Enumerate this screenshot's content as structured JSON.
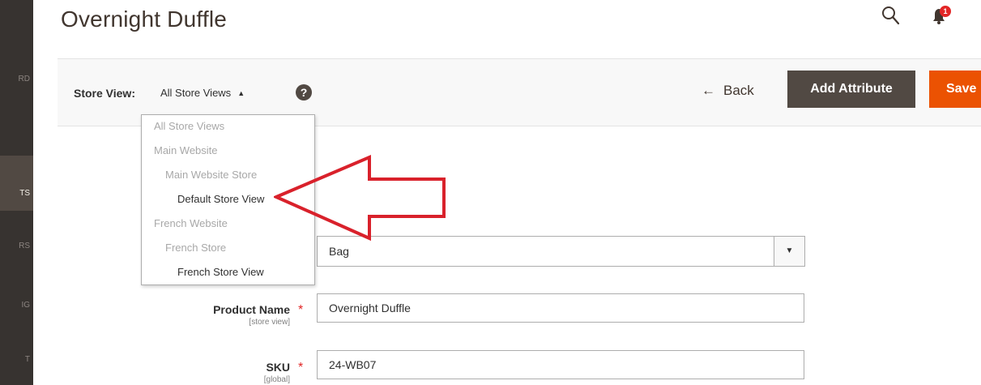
{
  "page": {
    "title": "Overnight Duffle"
  },
  "sidebar": {
    "items": [
      {
        "label": "RD",
        "active": false
      },
      {
        "label": "TS",
        "active": true
      },
      {
        "label": "RS",
        "active": false
      },
      {
        "label": "IG",
        "active": false
      },
      {
        "label": "T",
        "active": false
      }
    ]
  },
  "header": {
    "search_icon": "search-icon",
    "bell_icon": "bell-icon",
    "notification_count": "1"
  },
  "toolbar": {
    "store_view_label": "Store View:",
    "store_view_value": "All Store Views",
    "store_view_caret": "▲",
    "help_glyph": "?",
    "back_arrow": "←",
    "back_label": "Back",
    "add_attribute_label": "Add Attribute",
    "save_label": "Save"
  },
  "store_view_options": [
    {
      "label": "All Store Views",
      "level": 0,
      "selectable": false
    },
    {
      "label": "Main Website",
      "level": 0,
      "selectable": false
    },
    {
      "label": "Main Website Store",
      "level": 1,
      "selectable": false
    },
    {
      "label": "Default Store View",
      "level": 2,
      "selectable": true
    },
    {
      "label": "French Website",
      "level": 0,
      "selectable": false
    },
    {
      "label": "French Store",
      "level": 1,
      "selectable": false
    },
    {
      "label": "French Store View",
      "level": 2,
      "selectable": true
    }
  ],
  "form": {
    "attribute_set_value": "Bag",
    "attribute_set_toggle": "▼",
    "product_name": {
      "label": "Product Name",
      "scope": "[store view]",
      "value": "Overnight Duffle",
      "required_mark": "*"
    },
    "sku": {
      "label": "SKU",
      "scope": "[global]",
      "value": "24-WB07",
      "required_mark": "*"
    }
  },
  "colors": {
    "sidebar": "#373330",
    "primary_button": "#514943",
    "save_button": "#eb5202",
    "annotation_arrow": "#d9212b",
    "required_asterisk": "#e22626"
  }
}
